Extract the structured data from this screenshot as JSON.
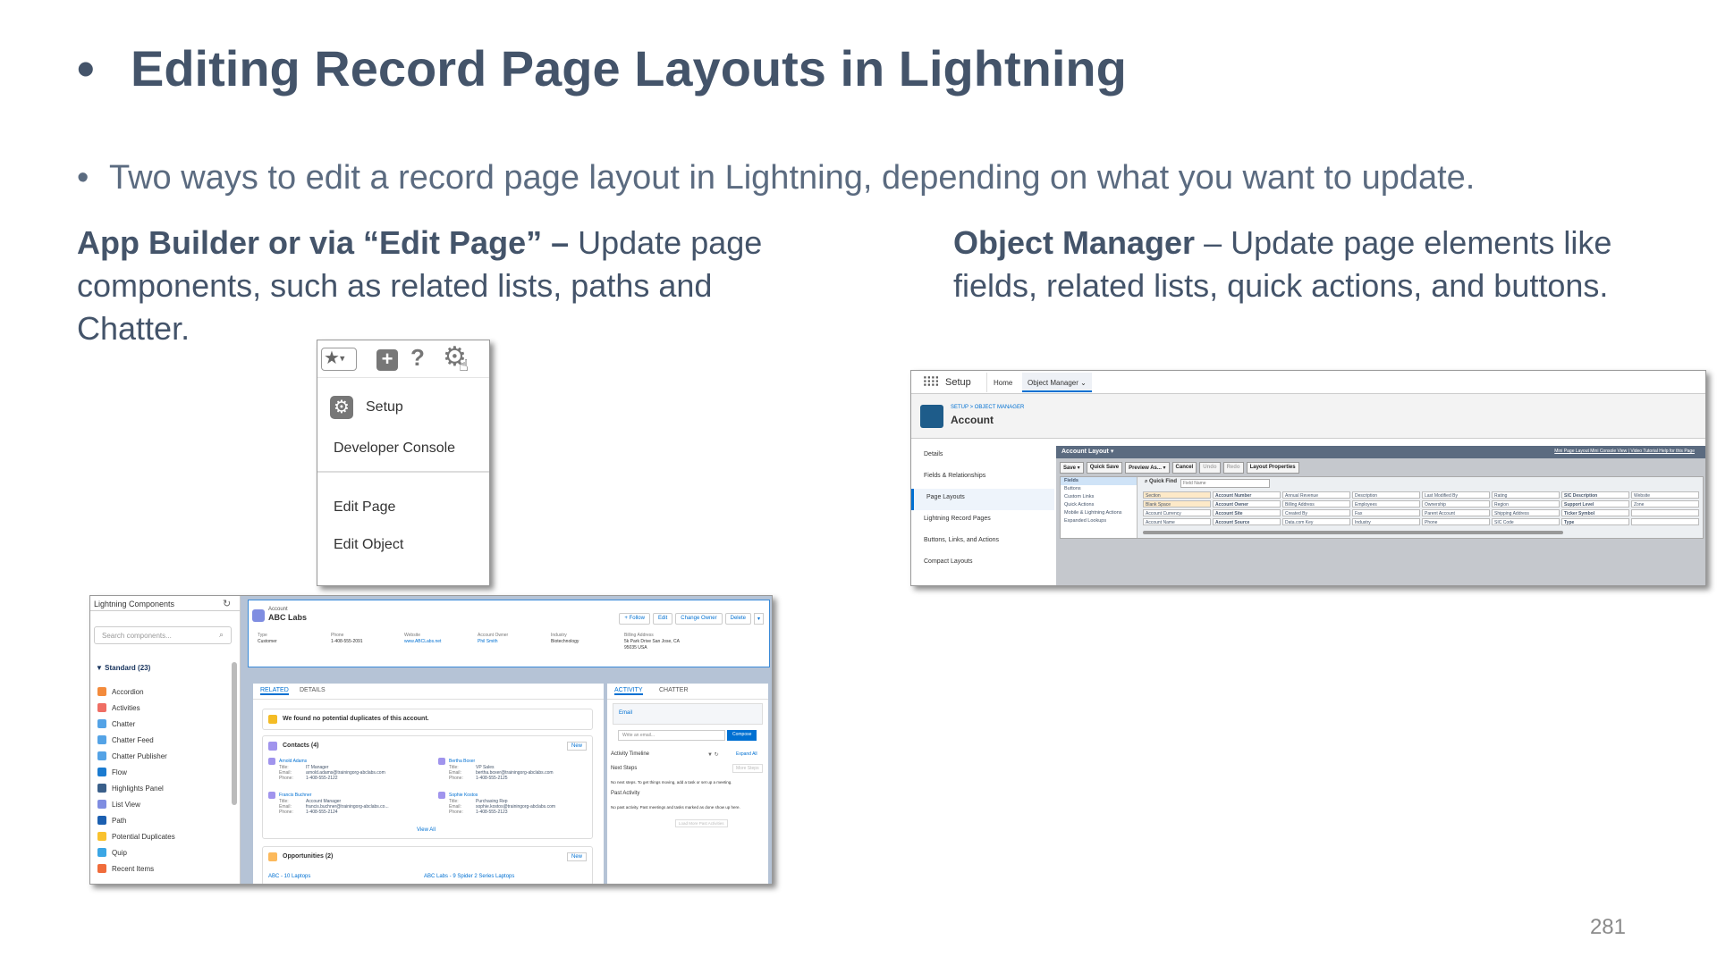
{
  "slide": {
    "title": "Editing Record Page Layouts in Lightning",
    "subtitle": "Two ways to edit a record page layout in Lightning, depending on what you want to update.",
    "left_heading": "App Builder or via “Edit Page” –",
    "left_text": " Update page components, such as related lists, paths and Chatter.",
    "right_heading": "Object Manager",
    "right_text": " – Update page elements like fields, related lists, quick actions, and buttons.",
    "page_number": "281"
  },
  "menu": {
    "items": [
      "Setup",
      "Developer Console",
      "Edit Page",
      "Edit Object"
    ]
  },
  "builder": {
    "panel_title": "Lightning Components",
    "search_placeholder": "Search components...",
    "section": "Standard (23)",
    "components": [
      "Accordion",
      "Activities",
      "Chatter",
      "Chatter Feed",
      "Chatter Publisher",
      "Flow",
      "Highlights Panel",
      "List View",
      "Path",
      "Potential Duplicates",
      "Quip",
      "Recent Items"
    ],
    "component_colors": [
      "#f38b3c",
      "#ef6e64",
      "#54a3e6",
      "#54a3e6",
      "#54a3e6",
      "#1b7bd0",
      "#3a5f8a",
      "#7f8de1",
      "#1b5fb0",
      "#f9c22e",
      "#3ba6e5",
      "#f06c3b"
    ],
    "record_type": "Account",
    "record_name": "ABC Labs",
    "buttons": [
      "+ Follow",
      "Edit",
      "Change Owner",
      "Delete"
    ],
    "fields": [
      {
        "label": "Type",
        "value": "Customer"
      },
      {
        "label": "Phone",
        "value": "1-408-555-2091"
      },
      {
        "label": "Website",
        "value": "www.ABCLabs.net"
      },
      {
        "label": "Account Owner",
        "value": "Phil Smith"
      },
      {
        "label": "Industry",
        "value": "Biotechnology"
      },
      {
        "label": "Billing Address",
        "value": "5k Park Drive San Jose, CA 95035 USA"
      }
    ],
    "tabs_left": [
      "RELATED",
      "DETAILS"
    ],
    "tabs_right": [
      "ACTIVITY",
      "CHATTER"
    ],
    "duplicates": "We found no potential duplicates of this account.",
    "contacts_title": "Contacts (4)",
    "new_label": "New",
    "contacts": [
      {
        "name": "Arnold Adams",
        "title": "IT Manager",
        "email": "arnold.adams@trainingorg-abclabs.com",
        "phone": "1-408-555-2122"
      },
      {
        "name": "Bertha Boxer",
        "title": "VP Sales",
        "email": "bertha.boxer@trainingorg-abclabs.com",
        "phone": "1-408-555-2125"
      },
      {
        "name": "Francis Buchner",
        "title": "Account Manager",
        "email": "francis.buchner@trainingorg-abclabs.co...",
        "phone": "1-408-555-2124"
      },
      {
        "name": "Sophie Kostos",
        "title": "Purchasing Rep",
        "email": "sophie.kostos@trainingorg-abclabs.com",
        "phone": "1-408-555-2123"
      }
    ],
    "row_labels": [
      "Title:",
      "Email:",
      "Phone:"
    ],
    "view_all": "View All",
    "opps_title": "Opportunities (2)",
    "opps": [
      "ABC - 10 Laptops",
      "ABC Labs - 9 Spider 2 Series Laptops"
    ],
    "activity": {
      "email_tab": "Email",
      "write_placeholder": "Write an email...",
      "compose": "Compose",
      "timeline": "Activity Timeline",
      "expand": "Expand All",
      "next_steps": "Next Steps",
      "more_steps": "More Steps",
      "next_text": "No next steps. To get things moving, add a task or set up a meeting.",
      "past": "Past Activity",
      "past_text": "No past activity. Past meetings and tasks marked as done show up here.",
      "load_more": "Load More Past Activities"
    }
  },
  "setup": {
    "app": "Setup",
    "tabs": [
      "Home",
      "Object Manager"
    ],
    "breadcrumb": "SETUP > OBJECT MANAGER",
    "object": "Account",
    "nav": [
      "Details",
      "Fields & Relationships",
      "Page Layouts",
      "Lightning Record Pages",
      "Buttons, Links, and Actions",
      "Compact Layouts"
    ],
    "layout_title": "Account Layout ▾",
    "layout_links": "Mini Page Layout  Mini Console View  |  Video Tutorial  Help for this Page",
    "toolbar": [
      "Save ▾",
      "Quick Save",
      "Preview As... ▾",
      "Cancel",
      "Undo",
      "Redo",
      "Layout Properties"
    ],
    "palette": [
      "Fields",
      "Buttons",
      "Custom Links",
      "Quick Actions",
      "Mobile & Lightning Actions",
      "Expanded Lookups"
    ],
    "quick_find": "Quick Find",
    "field_name_placeholder": "Field Name",
    "grid": [
      [
        "Section",
        "Account Number",
        "Annual Revenue",
        "Description",
        "Last Modified By",
        "Rating",
        "SIC Description",
        "Website"
      ],
      [
        "Blank Space",
        "Account Owner",
        "Billing Address",
        "Employees",
        "Ownership",
        "Region",
        "Support Level",
        "Zone"
      ],
      [
        "Account Currency",
        "Account Site",
        "Created By",
        "Fax",
        "Parent Account",
        "Shipping Address",
        "Ticker Symbol",
        ""
      ],
      [
        "Account Name",
        "Account Source",
        "Data.com Key",
        "Industry",
        "Phone",
        "SIC Code",
        "Type",
        ""
      ]
    ]
  }
}
